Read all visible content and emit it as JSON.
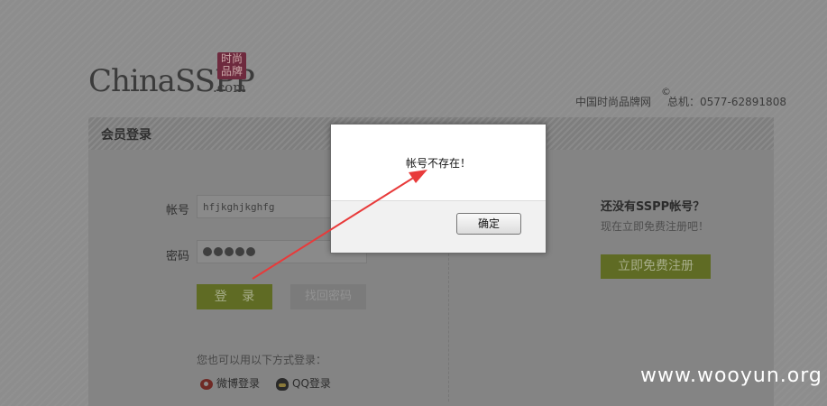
{
  "header": {
    "logo_text": "ChinaSSPP",
    "logo_suffix": ".com",
    "logo_seal": "时尚\n品牌",
    "site_name": "中国时尚品牌网",
    "copyright_mark": "©",
    "hotline": "总机：0577-62891808"
  },
  "login_panel": {
    "title": "会员登录",
    "account_label": "帐号",
    "account_value": "hfjkghjkghfg",
    "password_label": "密码",
    "password_dots": 5,
    "login_button": "登 录",
    "retrieve_button": "找回密码",
    "other_login_hint": "您也可以用以下方式登录：",
    "weibo_login": "微博登录",
    "qq_login": "QQ登录"
  },
  "register_panel": {
    "title": "还没有SSPP帐号？",
    "subtitle": "现在立即免费注册吧！",
    "register_button": "立即免费注册"
  },
  "dialog": {
    "message": "帐号不存在！",
    "ok_button": "确定"
  },
  "annotation": {
    "arrow_color": "#e83a3a"
  },
  "watermark": "www.wooyun.org"
}
